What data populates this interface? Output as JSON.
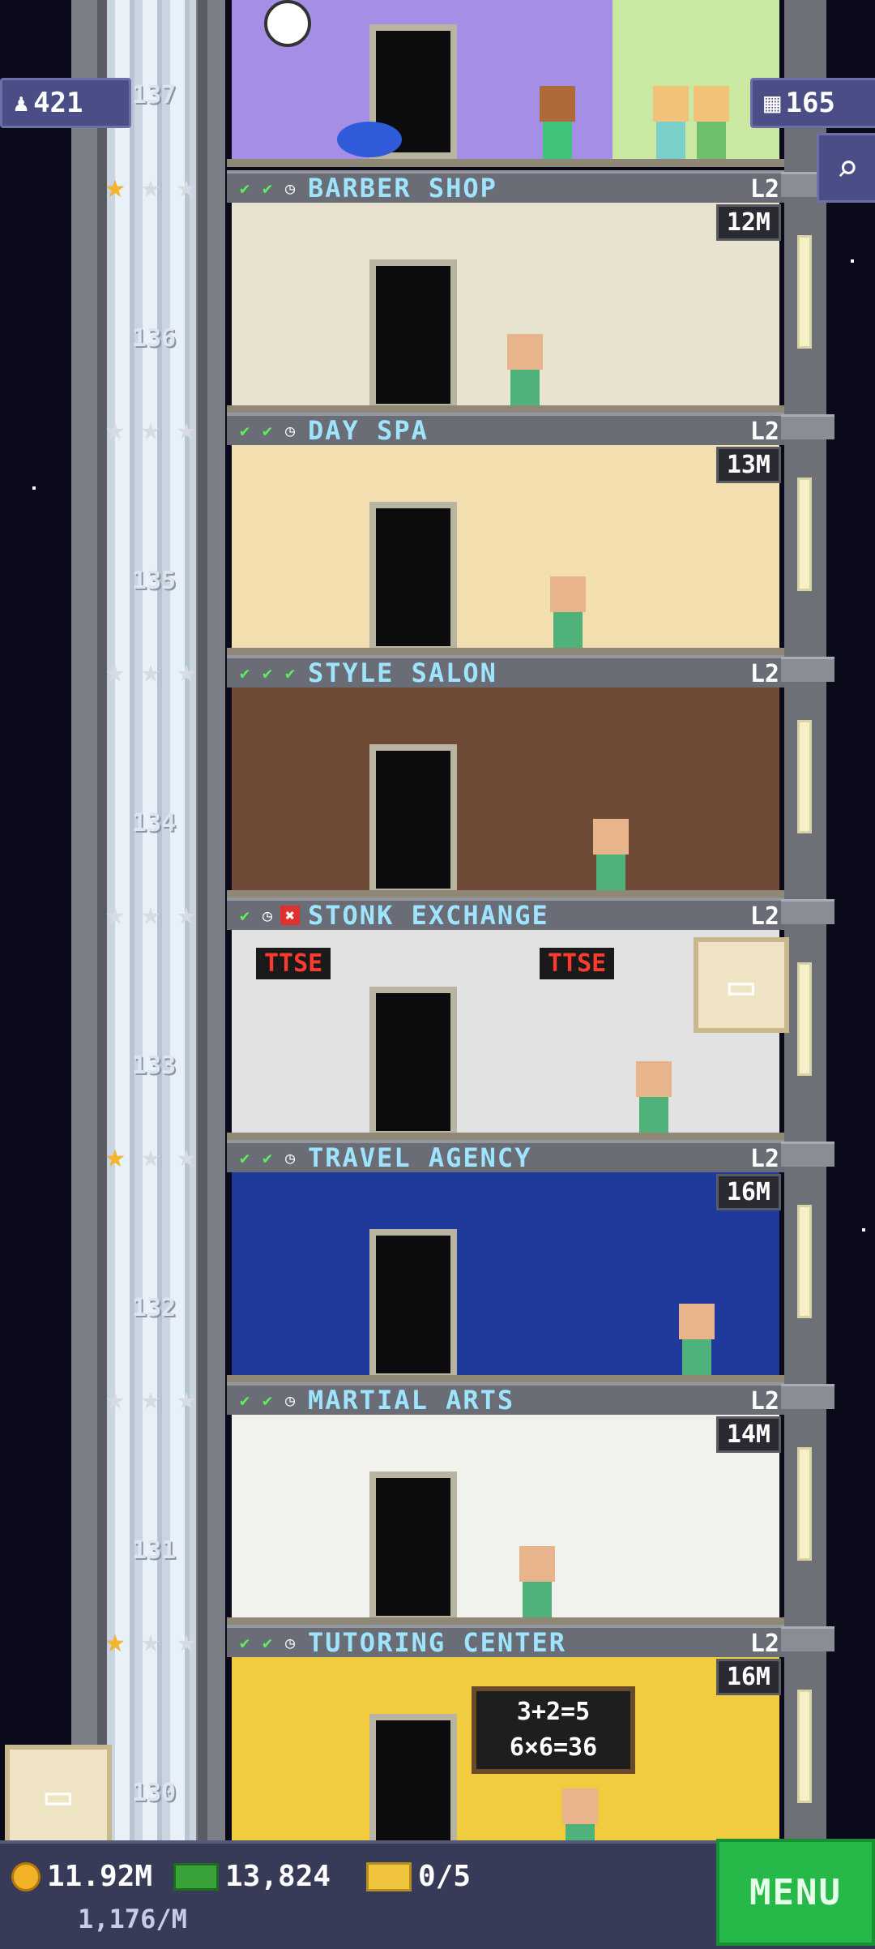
{
  "top": {
    "population": "421",
    "floor_count": "165",
    "top_floor_number": "137"
  },
  "floors": [
    {
      "name": "BARBER SHOP",
      "level": "L2",
      "number": "136",
      "earn": "12M",
      "checks": [
        "ok",
        "ok",
        "clock"
      ],
      "stars": [
        "gold",
        "silver",
        "silver"
      ],
      "wall": "#e7e3cf"
    },
    {
      "name": "DAY SPA",
      "level": "L2",
      "number": "135",
      "earn": "13M",
      "checks": [
        "ok",
        "ok",
        "clock"
      ],
      "stars": [
        "silver",
        "silver",
        "silver"
      ],
      "wall": "#f3deb0"
    },
    {
      "name": "STYLE SALON",
      "level": "L2",
      "number": "134",
      "earn": "",
      "checks": [
        "ok",
        "ok",
        "ok"
      ],
      "stars": [
        "silver",
        "silver",
        "silver"
      ],
      "wall": "#6f4a36"
    },
    {
      "name": "STONK EXCHANGE",
      "level": "L2",
      "number": "133",
      "earn": "",
      "checks": [
        "ok",
        "clock",
        "bad"
      ],
      "stars": [
        "silver",
        "silver",
        "silver"
      ],
      "wall": "#e2e2e2",
      "signs": [
        "TTSE",
        "TTSE"
      ]
    },
    {
      "name": "TRAVEL AGENCY",
      "level": "L2",
      "number": "132",
      "earn": "16M",
      "checks": [
        "ok",
        "ok",
        "clock"
      ],
      "stars": [
        "gold",
        "silver",
        "silver"
      ],
      "wall": "#1f3a9a"
    },
    {
      "name": "MARTIAL ARTS",
      "level": "L2",
      "number": "131",
      "earn": "14M",
      "checks": [
        "ok",
        "ok",
        "clock"
      ],
      "stars": [
        "silver",
        "silver",
        "silver"
      ],
      "wall": "#f1f1ee"
    },
    {
      "name": "TUTORING CENTER",
      "level": "L2",
      "number": "130",
      "earn": "16M",
      "checks": [
        "ok",
        "ok",
        "clock"
      ],
      "stars": [
        "gold",
        "silver",
        "silver"
      ],
      "wall": "#f2cc3f",
      "board": [
        "3+2=5",
        "6×6=36"
      ]
    }
  ],
  "bottom": {
    "coins": "11.92M",
    "coin_rate": "1,176/M",
    "bux": "13,824",
    "tickets": "0/5",
    "menu_label": "MENU"
  },
  "icons": {
    "check": "✔",
    "clock": "◷",
    "cross": "✖",
    "star": "★",
    "person": "♟",
    "grid": "▦",
    "search": "⌕",
    "box": "▭"
  }
}
